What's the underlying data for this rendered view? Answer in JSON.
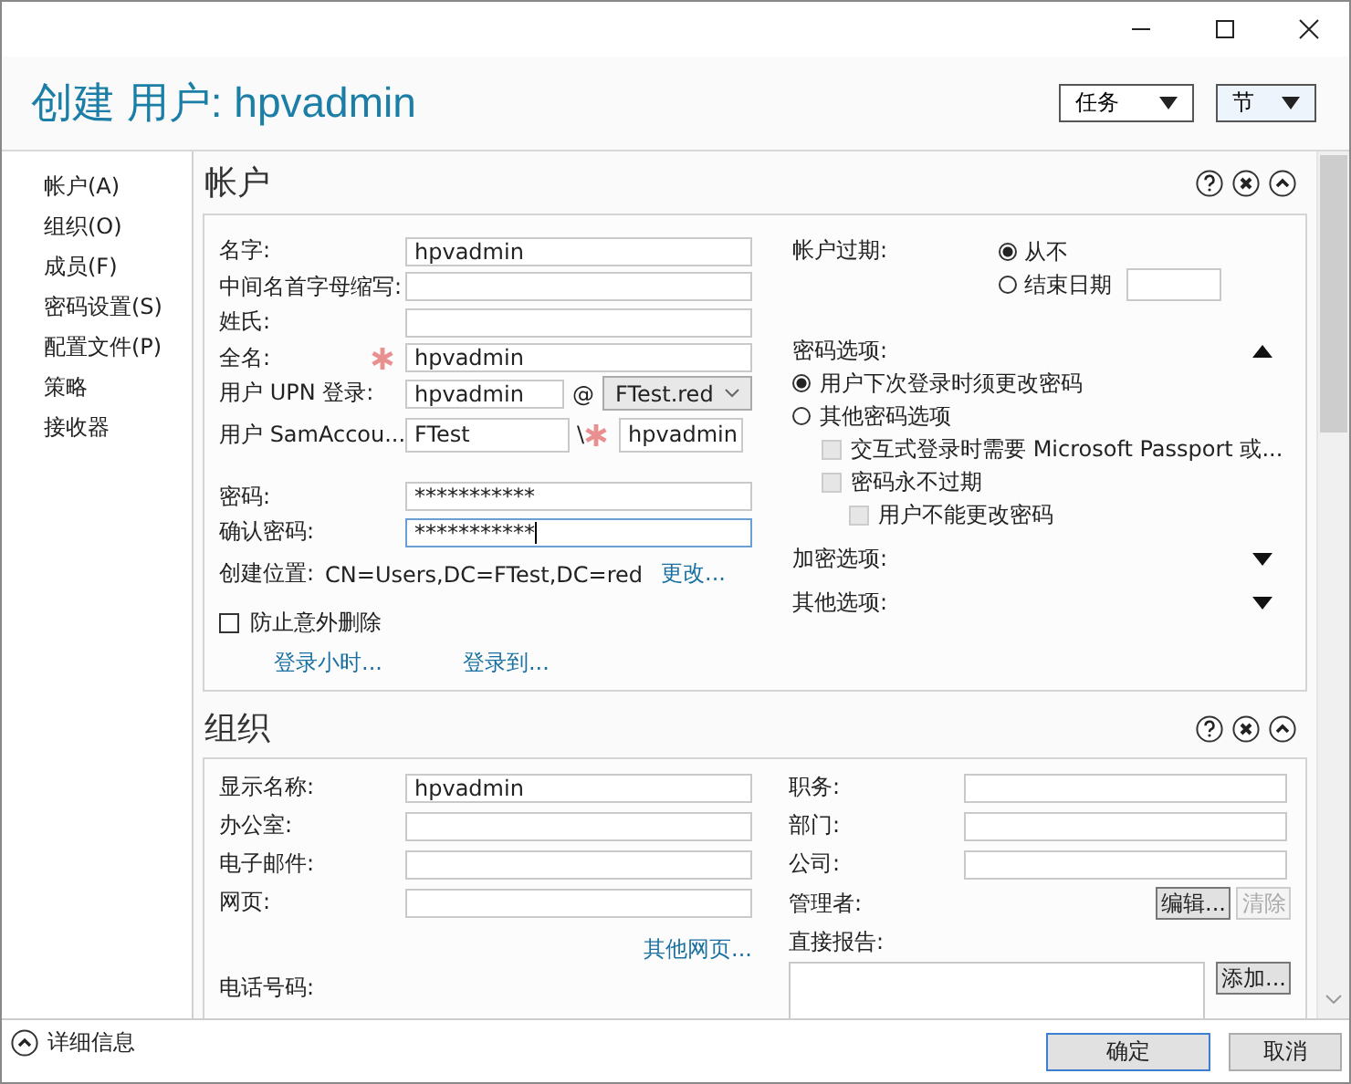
{
  "window": {
    "title": "创建 用户: hpvadmin"
  },
  "header_menus": [
    {
      "label": "任务",
      "highlighted": false
    },
    {
      "label": "节",
      "highlighted": true
    }
  ],
  "sidebar": {
    "items": [
      {
        "label": "帐户(A)"
      },
      {
        "label": "组织(O)"
      },
      {
        "label": "成员(F)"
      },
      {
        "label": "密码设置(S)"
      },
      {
        "label": "配置文件(P)"
      },
      {
        "label": "策略"
      },
      {
        "label": "接收器"
      }
    ]
  },
  "account": {
    "title": "帐户",
    "fields": [
      {
        "kind": "text",
        "label": "名字:",
        "value": "hpvadmin",
        "required": false
      },
      {
        "kind": "text",
        "label": "中间名首字母缩写:",
        "required": false
      },
      {
        "kind": "text",
        "label": "姓氏:",
        "required": false
      },
      {
        "kind": "text",
        "label": "全名:",
        "value": "hpvadmin",
        "required": true
      },
      {
        "kind": "upn",
        "label": "用户 UPN 登录:",
        "value": "hpvadmin",
        "separator": "@",
        "domain": "FTest.red",
        "required": false
      },
      {
        "kind": "sam",
        "label": "用户 SamAccou...",
        "domain": "FTest",
        "separator": "\\",
        "value": "hpvadmin",
        "required": true
      }
    ],
    "password_fields": [
      {
        "label": "密码:",
        "value": "***********",
        "focused": false
      },
      {
        "label": "确认密码:",
        "value": "***********",
        "focused": true
      }
    ],
    "location": {
      "label": "创建位置:",
      "value": "CN=Users,DC=FTest,DC=red",
      "link": "更改..."
    },
    "protect": {
      "label": "防止意外删除",
      "checked": false
    },
    "links": [
      "登录小时...",
      "登录到..."
    ],
    "expiry": {
      "label": "帐户过期:",
      "options": [
        {
          "label": "从不",
          "selected": true,
          "has_field": false
        },
        {
          "label": "结束日期",
          "selected": false,
          "has_field": true
        }
      ]
    },
    "password_options": {
      "label": "密码选项:",
      "expanded": true,
      "options": [
        {
          "label": "用户下次登录时须更改密码",
          "selected": true
        },
        {
          "label": "其他密码选项",
          "selected": false
        }
      ],
      "checkboxes": [
        {
          "label": "交互式登录时需要 Microsoft Passport 或...",
          "checked": false,
          "disabled": true
        },
        {
          "label": "密码永不过期",
          "checked": false,
          "disabled": true,
          "children": [
            {
              "label": "用户不能更改密码",
              "checked": false,
              "disabled": true
            }
          ]
        }
      ]
    },
    "more_sections": [
      {
        "label": "加密选项:",
        "expanded": false
      },
      {
        "label": "其他选项:",
        "expanded": false
      }
    ]
  },
  "organization": {
    "title": "组织",
    "left_fields": [
      {
        "label": "显示名称:",
        "value": "hpvadmin"
      },
      {
        "label": "办公室:"
      },
      {
        "label": "电子邮件:"
      },
      {
        "label": "网页:"
      }
    ],
    "link": "其他网页...",
    "cut_label": "电话号码:",
    "right_fields": [
      {
        "label": "职务:"
      },
      {
        "label": "部门:"
      },
      {
        "label": "公司:"
      }
    ],
    "manager": {
      "label": "管理者:",
      "buttons": [
        {
          "label": "编辑...",
          "disabled": false
        },
        {
          "label": "清除",
          "disabled": true
        }
      ]
    },
    "reports": {
      "label": "直接报告:",
      "button": "添加..."
    }
  },
  "footer": {
    "details": "详细信息",
    "buttons": [
      {
        "label": "确定",
        "default": true
      },
      {
        "label": "取消",
        "default": false
      }
    ]
  }
}
